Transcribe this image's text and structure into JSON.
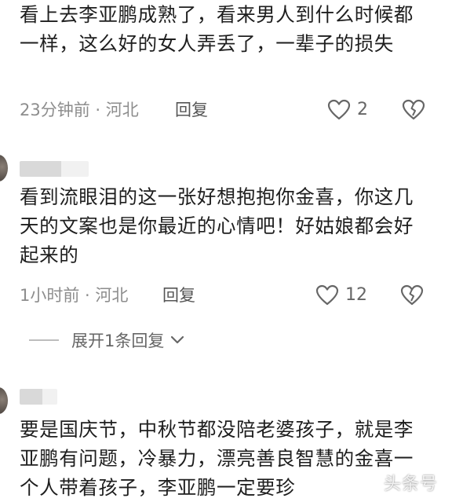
{
  "comments": [
    {
      "text": "看上去李亚鹏成熟了，看来男人到什么时候都一样，这么好的女人弄丢了，一辈子的损失",
      "time_location": "23分钟前 · 河北",
      "reply_label": "回复",
      "like_count": "2"
    },
    {
      "text": "看到流眼泪的这一张好想抱抱你金喜，你这几天的文案也是你最近的心情吧！好姑娘都会好起来的",
      "time_location": "1小时前 · 河北",
      "reply_label": "回复",
      "like_count": "12",
      "expand_label": "展开1条回复"
    },
    {
      "text": "要是国庆节，中秋节都没陪老婆孩子，就是李亚鹏有问题，冷暴力，漂亮善良智慧的金喜一个人带着孩子，李亚鹏一定要珍"
    }
  ],
  "icons": {
    "like": "heart-outline-icon",
    "dislike": "broken-heart-icon",
    "expand": "chevron-down-icon"
  },
  "colors": {
    "text": "#1e1e1e",
    "meta": "#8d8d8d",
    "icon": "#666666"
  },
  "watermark": "头条号"
}
